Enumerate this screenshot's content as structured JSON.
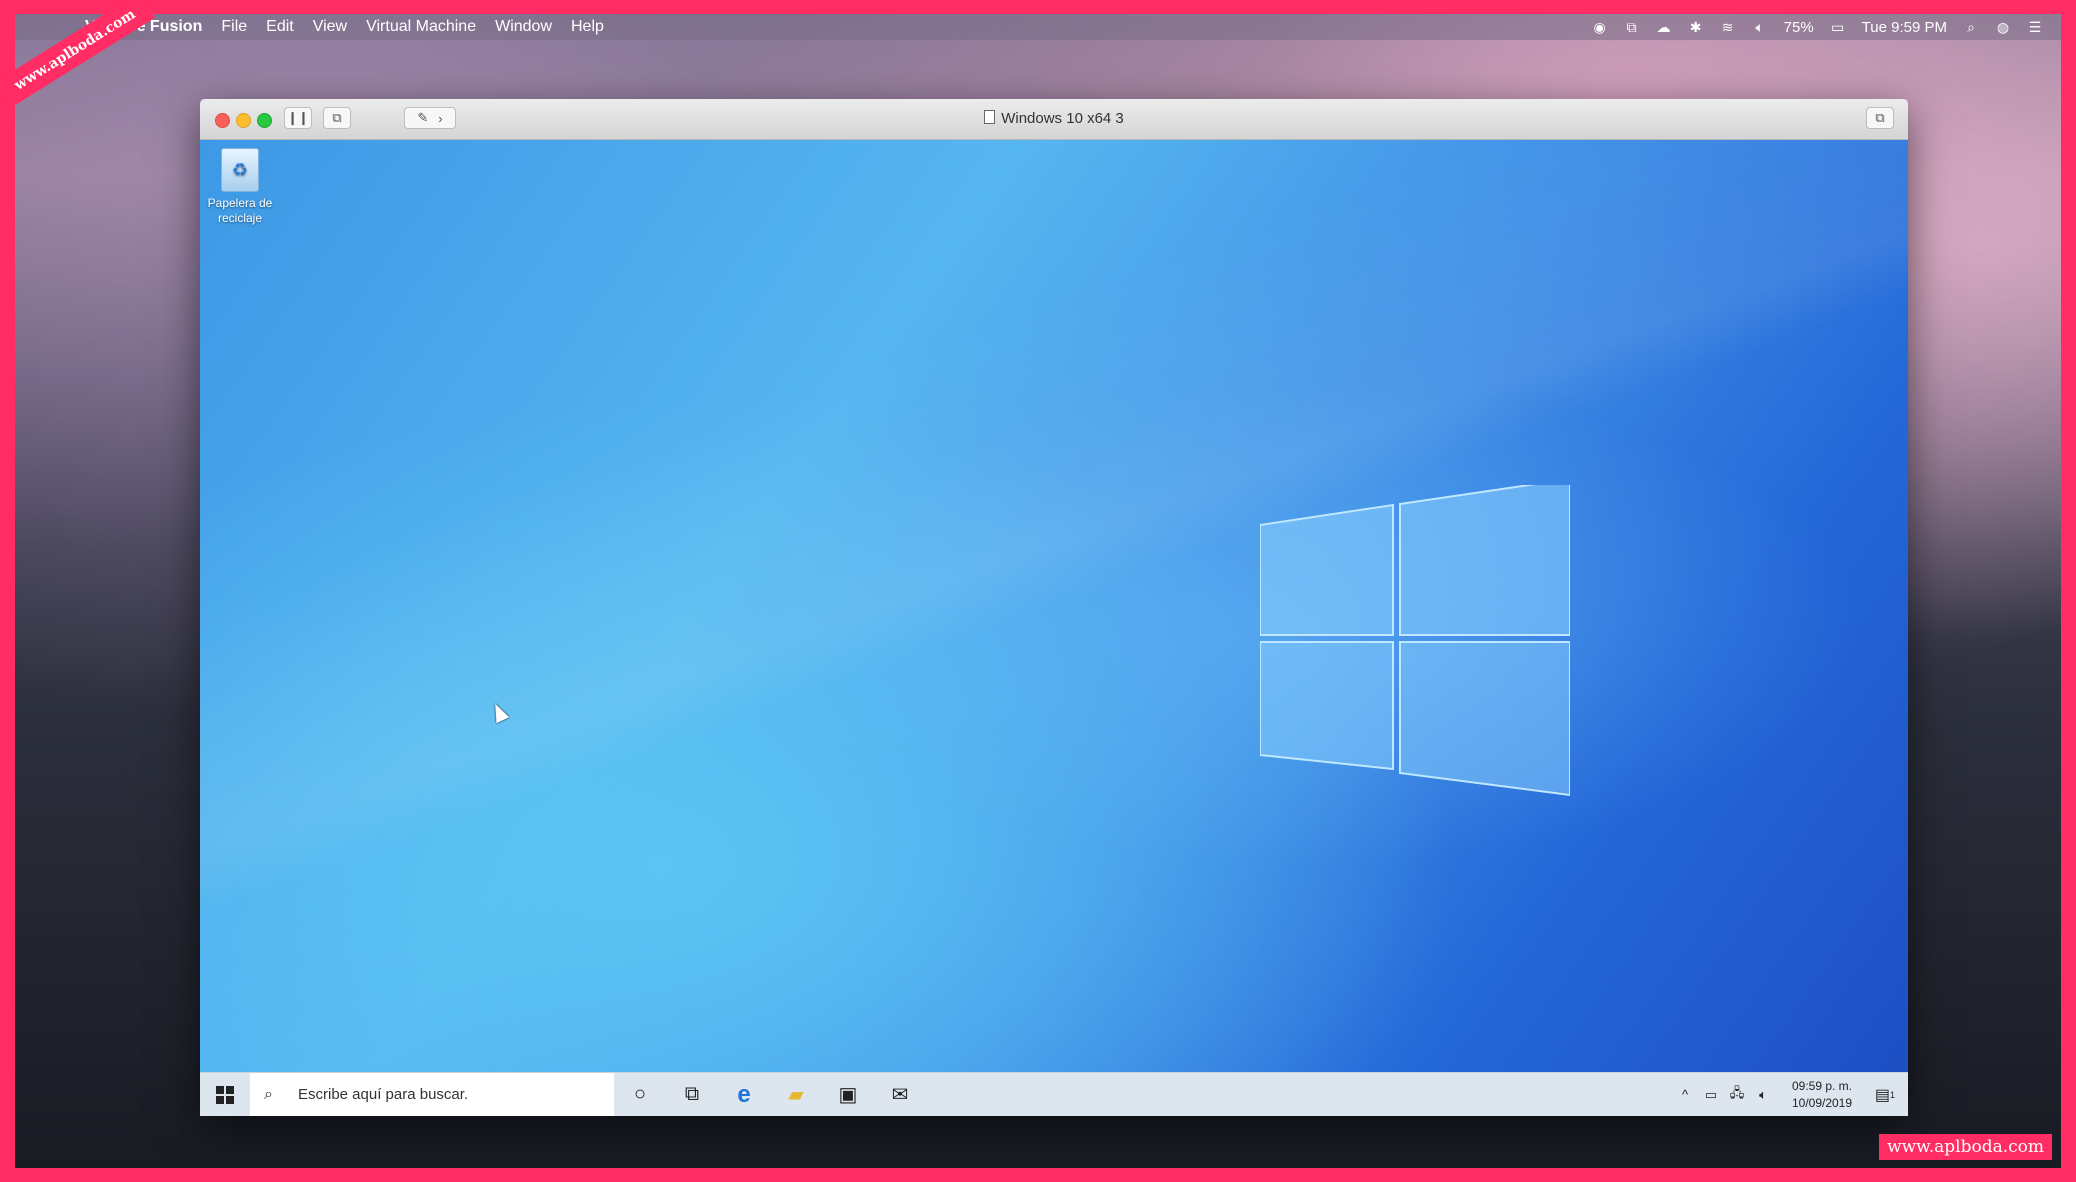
{
  "menubar": {
    "app_name": "VMware Fusion",
    "items": [
      "File",
      "Edit",
      "View",
      "Virtual Machine",
      "Window",
      "Help"
    ],
    "battery": "75%",
    "clock": "Tue 9:59 PM"
  },
  "watermark": {
    "ribbon": "www.aplboda.com",
    "corner": "www.aplboda.com"
  },
  "vm_window": {
    "title": "Windows 10 x64 3"
  },
  "windows": {
    "desktop_icon_label": "Papelera de reciclaje",
    "search_placeholder": "Escribe aquí para buscar.",
    "time": "09:59 p. m.",
    "date": "10/09/2019",
    "notification_count": "1"
  },
  "colors": {
    "frame": "#ff2d63",
    "windows_blue": "#3d98e6"
  }
}
